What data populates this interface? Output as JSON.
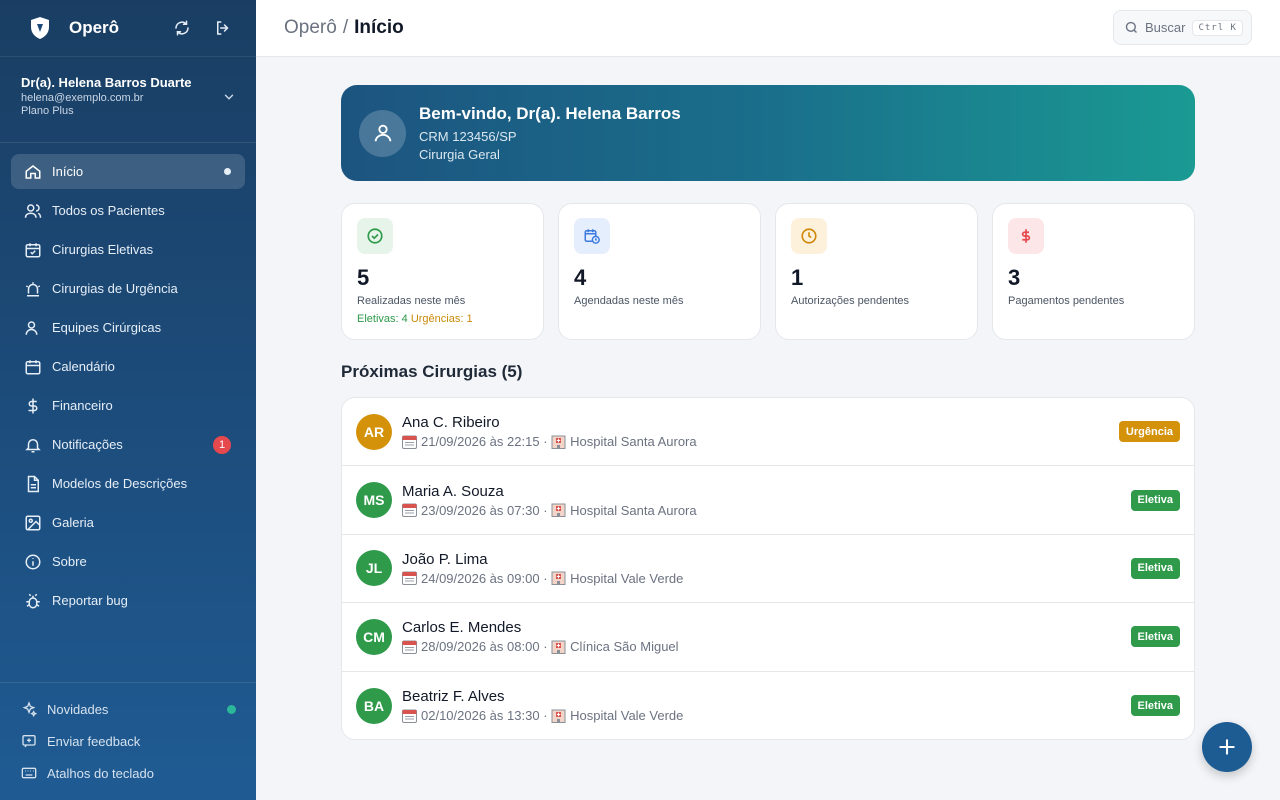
{
  "app": {
    "name": "Operô"
  },
  "profile": {
    "name": "Dr(a). Helena Barros Duarte",
    "email": "helena@exemplo.com.br",
    "plan": "Plano Plus"
  },
  "sidebar": {
    "items": [
      {
        "label": "Início",
        "icon": "home-icon",
        "active": true
      },
      {
        "label": "Todos os Pacientes",
        "icon": "users-icon"
      },
      {
        "label": "Cirurgias Eletivas",
        "icon": "calendar-check-icon"
      },
      {
        "label": "Cirurgias de Urgência",
        "icon": "siren-icon"
      },
      {
        "label": "Equipes Cirúrgicas",
        "icon": "team-icon"
      },
      {
        "label": "Calendário",
        "icon": "calendar-icon"
      },
      {
        "label": "Financeiro",
        "icon": "dollar-icon"
      },
      {
        "label": "Notificações",
        "icon": "bell-icon",
        "badge": "1"
      },
      {
        "label": "Modelos de Descrições",
        "icon": "document-icon"
      },
      {
        "label": "Galeria",
        "icon": "gallery-icon"
      },
      {
        "label": "Sobre",
        "icon": "info-icon"
      },
      {
        "label": "Reportar bug",
        "icon": "bug-icon"
      }
    ],
    "footer": [
      {
        "label": "Novidades",
        "icon": "sparkles-icon"
      },
      {
        "label": "Enviar feedback",
        "icon": "feedback-icon"
      },
      {
        "label": "Atalhos do teclado",
        "icon": "keyboard-icon"
      }
    ]
  },
  "topbar": {
    "breadcrumb_root": "Operô",
    "breadcrumb_sep": "/",
    "breadcrumb_current": "Início",
    "search_label": "Buscar",
    "search_shortcut": "Ctrl K"
  },
  "welcome": {
    "title": "Bem-vindo, Dr(a). Helena Barros",
    "crm": "CRM 123456/SP",
    "specialty": "Cirurgia Geral"
  },
  "stats": [
    {
      "value": "5",
      "label": "Realizadas neste mês",
      "extra_eletivas": "Eletivas: 4",
      "extra_urgencias": "Urgências: 1",
      "icon": "check-circle-icon",
      "color": "#2e9a4a"
    },
    {
      "value": "4",
      "label": "Agendadas neste mês",
      "icon": "calendar-clock-icon",
      "color": "#3b7be0"
    },
    {
      "value": "1",
      "label": "Autorizações pendentes",
      "icon": "clock-icon",
      "color": "#d08a0b"
    },
    {
      "value": "3",
      "label": "Pagamentos pendentes",
      "icon": "dollar-icon",
      "color": "#e5484d"
    }
  ],
  "upcoming": {
    "title": "Próximas Cirurgias (5)",
    "rows": [
      {
        "initials": "AR",
        "name": "Ana C. Ribeiro",
        "datetime": "21/09/2026 às 22:15",
        "sep": "·",
        "place": "Hospital Santa Aurora",
        "tag": "Urgência",
        "color": "#d4920b"
      },
      {
        "initials": "MS",
        "name": "Maria A. Souza",
        "datetime": "23/09/2026 às 07:30",
        "sep": "·",
        "place": "Hospital Santa Aurora",
        "tag": "Eletiva",
        "color": "#2e9a4a"
      },
      {
        "initials": "JL",
        "name": "João P. Lima",
        "datetime": "24/09/2026 às 09:00",
        "sep": "·",
        "place": "Hospital Vale Verde",
        "tag": "Eletiva",
        "color": "#2e9a4a"
      },
      {
        "initials": "CM",
        "name": "Carlos E. Mendes",
        "datetime": "28/09/2026 às 08:00",
        "sep": "·",
        "place": "Clínica São Miguel",
        "tag": "Eletiva",
        "color": "#2e9a4a"
      },
      {
        "initials": "BA",
        "name": "Beatriz F. Alves",
        "datetime": "02/10/2026 às 13:30",
        "sep": "·",
        "place": "Hospital Vale Verde",
        "tag": "Eletiva",
        "color": "#2e9a4a"
      }
    ]
  },
  "colors": {
    "sidebar": "#1c4a78",
    "accent": "#1d5c93",
    "eletiva": "#2e9a4a",
    "urgencia": "#d4920b",
    "badge": "#e5484d"
  }
}
